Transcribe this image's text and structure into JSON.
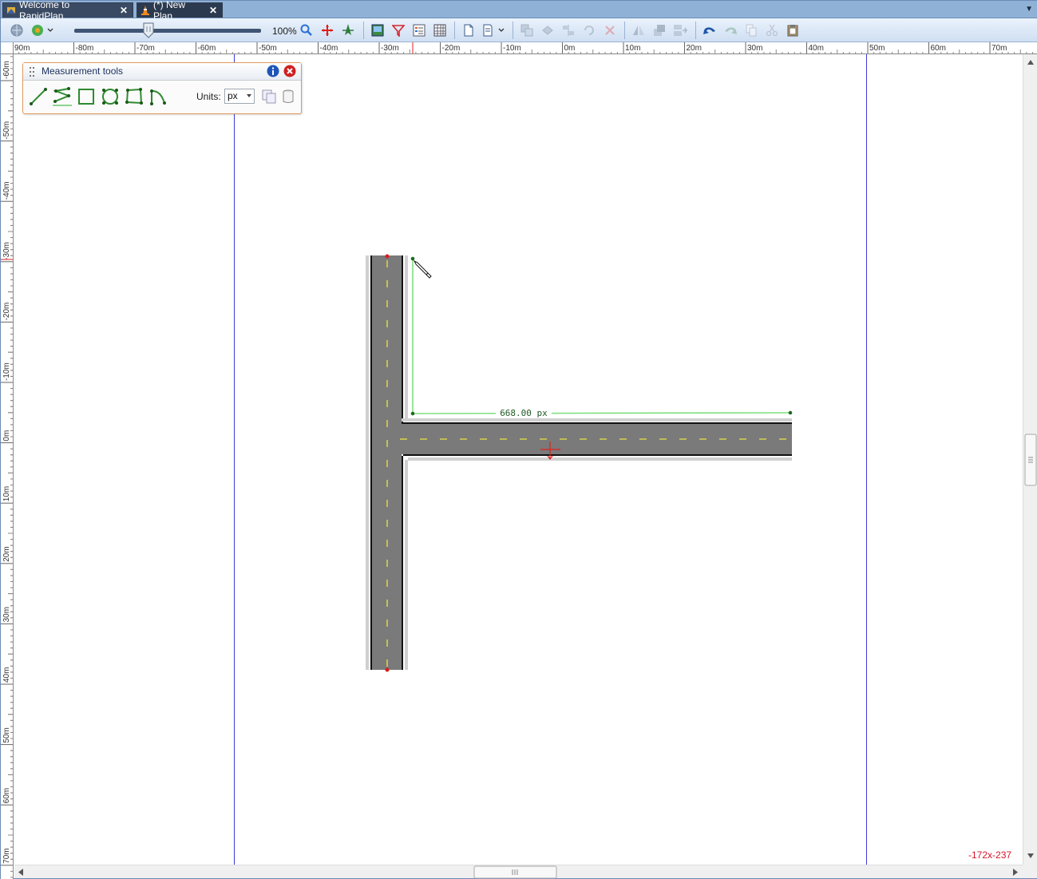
{
  "tabs": [
    {
      "label": "Welcome to RapidPlan",
      "icon": "rapidplan-logo-icon",
      "close": "✕"
    },
    {
      "label": "(*) New Plan",
      "icon": "traffic-cone-icon",
      "close": "✕"
    }
  ],
  "toolbar": {
    "zoom_level": "100%",
    "zoom_fraction": 0.4
  },
  "ruler_h": [
    "90m",
    "-80m",
    "-70m",
    "-60m",
    "-50m",
    "-40m",
    "-30m",
    "-20m",
    "-10m",
    "0m",
    "10m",
    "20m",
    "30m",
    "40m",
    "50m",
    "60m",
    "70m"
  ],
  "ruler_v": [
    "-60m",
    "-50m",
    "-40m",
    "-30m",
    "-20m",
    "-10m",
    "0m",
    "10m",
    "20m",
    "30m",
    "40m",
    "50m",
    "60m",
    "70m"
  ],
  "measurement_panel": {
    "title": "Measurement tools",
    "units_label": "Units:",
    "units_value": "px",
    "tools": [
      "line-measure-icon",
      "polyline-measure-icon",
      "rectangle-measure-icon",
      "circle-measure-icon",
      "polygon-measure-icon",
      "arc-measure-icon"
    ]
  },
  "measurement": {
    "label": "668.00 px"
  },
  "status": {
    "coordinates": "-172x-237"
  },
  "colors": {
    "road": "#7a7a7a",
    "centerline": "#d6d24a",
    "measure_line": "#7ee07e",
    "page_border": "#3b3bd6",
    "endpoint": "#d81e1e"
  }
}
